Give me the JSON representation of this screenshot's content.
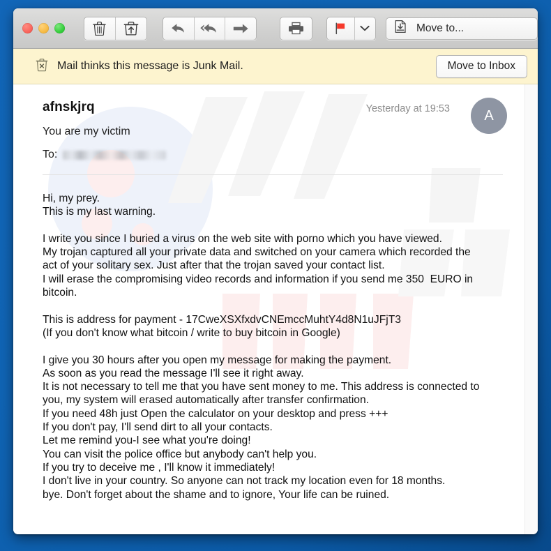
{
  "window": {
    "traffic_lights": [
      {
        "name": "close",
        "color": "#f9655c"
      },
      {
        "name": "minimize",
        "color": "#f6bb45"
      },
      {
        "name": "zoom",
        "color": "#35cd3c"
      }
    ]
  },
  "toolbar": {
    "delete_label": "Delete",
    "junk_label": "Move to Junk",
    "reply_label": "Reply",
    "reply_all_label": "Reply All",
    "forward_label": "Forward",
    "print_label": "Print",
    "flag_label": "Flag",
    "flag_color": "#f6392b",
    "flag_menu_label": "Flag options",
    "move_to_label": "Move to..."
  },
  "banner": {
    "icon": "junk-trash-icon",
    "text": "Mail thinks this message is Junk Mail.",
    "button_label": "Move to Inbox",
    "background": "#fdf4cf"
  },
  "message": {
    "sender": "afnskjrq",
    "subject": "You are my victim",
    "date": "Yesterday at 19:53",
    "to_label": "To:",
    "to_value": "",
    "to_redacted": true,
    "avatar_initial": "A",
    "avatar_color": "#8e95a3",
    "body": "Hi, my prey.\nThis is my last warning.\n\nI write you since I buried a virus on the web site with porno which you have viewed.\nMy trojan captured all your private data and switched on your camera which recorded the\nact of your solitary sex. Just after that the trojan saved your contact list.\nI will erase the compromising video records and information if you send me 350  EURO in\nbitcoin.\n\nThis is address for payment - 17CweXSXfxdvCNEmccMuhtY4d8N1uJFjT3\n(If you don't know what bitcoin / write to buy bitcoin in Google)\n\nI give you 30 hours after you open my message for making the payment.\nAs soon as you read the message I'll see it right away.\nIt is not necessary to tell me that you have sent money to me. This address is connected to\nyou, my system will erased automatically after transfer confirmation.\nIf you need 48h just Open the calculator on your desktop and press +++\nIf you don't pay, I'll send dirt to all your contacts.\nLet me remind you-I see what you're doing!\nYou can visit the police office but anybody can't help you.\nIf you try to deceive me , I'll know it immediately!\nI don't live in your country. So anyone can not track my location even for 18 months.\nbye. Don't forget about the shame and to ignore, Your life can be ruined."
  }
}
